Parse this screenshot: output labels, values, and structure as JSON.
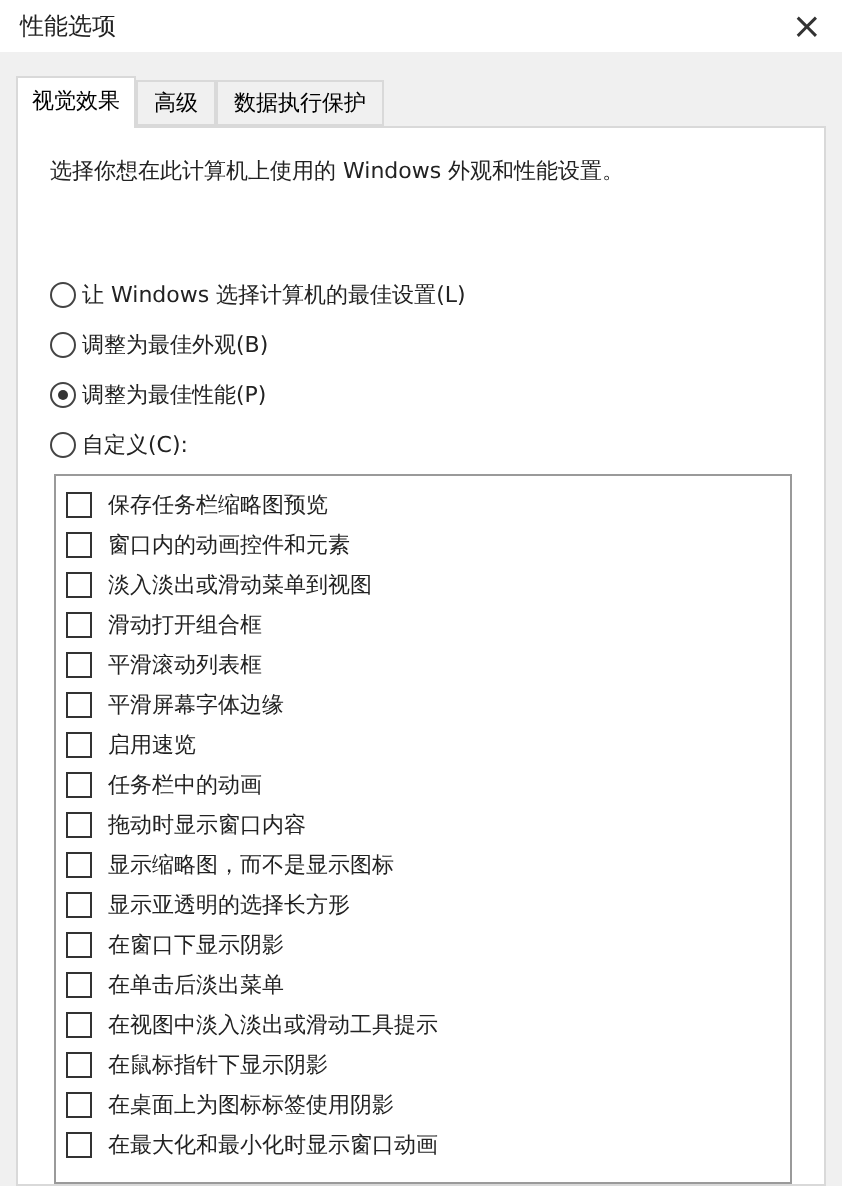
{
  "window": {
    "title": "性能选项",
    "close": "×"
  },
  "tabs": [
    {
      "label": "视觉效果",
      "selected": true
    },
    {
      "label": "高级",
      "selected": false
    },
    {
      "label": "数据执行保护",
      "selected": false
    }
  ],
  "description": "选择你想在此计算机上使用的 Windows 外观和性能设置。",
  "options": [
    {
      "label": "让 Windows 选择计算机的最佳设置(L)",
      "selected": false
    },
    {
      "label": "调整为最佳外观(B)",
      "selected": false
    },
    {
      "label": "调整为最佳性能(P)",
      "selected": true
    },
    {
      "label": "自定义(C):",
      "selected": false
    }
  ],
  "effects": [
    {
      "label": "保存任务栏缩略图预览",
      "checked": false
    },
    {
      "label": "窗口内的动画控件和元素",
      "checked": false
    },
    {
      "label": "淡入淡出或滑动菜单到视图",
      "checked": false
    },
    {
      "label": "滑动打开组合框",
      "checked": false
    },
    {
      "label": "平滑滚动列表框",
      "checked": false
    },
    {
      "label": "平滑屏幕字体边缘",
      "checked": false
    },
    {
      "label": "启用速览",
      "checked": false
    },
    {
      "label": "任务栏中的动画",
      "checked": false
    },
    {
      "label": "拖动时显示窗口内容",
      "checked": false
    },
    {
      "label": "显示缩略图，而不是显示图标",
      "checked": false
    },
    {
      "label": "显示亚透明的选择长方形",
      "checked": false
    },
    {
      "label": "在窗口下显示阴影",
      "checked": false
    },
    {
      "label": "在单击后淡出菜单",
      "checked": false
    },
    {
      "label": "在视图中淡入淡出或滑动工具提示",
      "checked": false
    },
    {
      "label": "在鼠标指针下显示阴影",
      "checked": false
    },
    {
      "label": "在桌面上为图标标签使用阴影",
      "checked": false
    },
    {
      "label": "在最大化和最小化时显示窗口动画",
      "checked": false
    }
  ]
}
